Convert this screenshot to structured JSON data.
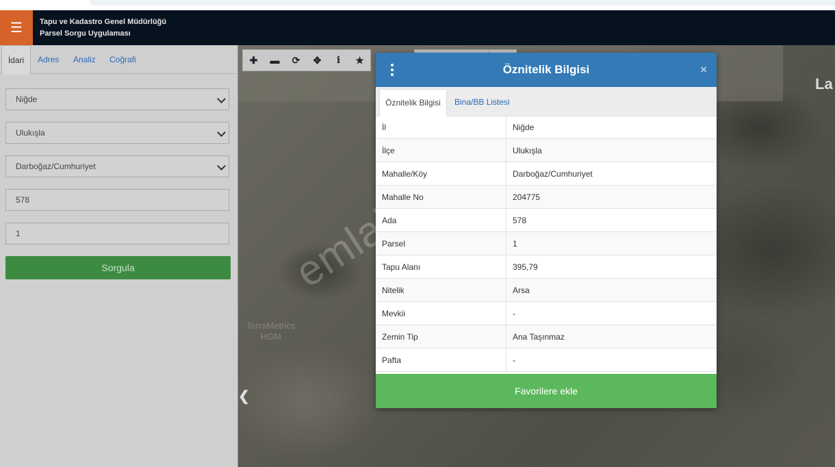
{
  "header": {
    "menu_icon": "hamburger-icon",
    "title_line1": "Tapu ve Kadastro Genel Müdürlüğü",
    "title_line2": "Parsel Sorgu Uygulaması"
  },
  "sidebar": {
    "tabs": [
      {
        "label": "İdari",
        "active": true
      },
      {
        "label": "Adres",
        "active": false
      },
      {
        "label": "Analiz",
        "active": false
      },
      {
        "label": "Coğrafi",
        "active": false
      }
    ],
    "province": "Niğde",
    "district": "Ulukışla",
    "neighborhood": "Darboğaz/Cumhuriyet",
    "block": "578",
    "parcel": "1",
    "query_button": "Sorgula"
  },
  "map": {
    "toolbar_icons": [
      "plus-icon",
      "minus-icon",
      "refresh-icon",
      "crosshair-icon",
      "info-icon",
      "star-icon"
    ],
    "watermark": "emlakjet.com",
    "edge_label": "La",
    "faint_text": "TerraMetrics\nHGM"
  },
  "modal": {
    "title": "Öznitelik Bilgisi",
    "close": "×",
    "tabs": [
      {
        "label": "Öznitelik Bilgisi",
        "active": true
      },
      {
        "label": "Bina/BB Listesi",
        "active": false
      }
    ],
    "rows": [
      {
        "key": "İl",
        "value": "Niğde"
      },
      {
        "key": "İlçe",
        "value": "Ulukışla"
      },
      {
        "key": "Mahalle/Köy",
        "value": "Darboğaz/Cumhuriyet"
      },
      {
        "key": "Mahalle No",
        "value": "204775"
      },
      {
        "key": "Ada",
        "value": "578"
      },
      {
        "key": "Parsel",
        "value": "1"
      },
      {
        "key": "Tapu Alanı",
        "value": "395,79"
      },
      {
        "key": "Nitelik",
        "value": "Arsa"
      },
      {
        "key": "Mevkii",
        "value": "-"
      },
      {
        "key": "Zemin Tip",
        "value": "Ana Taşınmaz"
      },
      {
        "key": "Pafta",
        "value": "-"
      }
    ],
    "favorite_button": "Favorilere ekle"
  },
  "colors": {
    "navbar": "#07121f",
    "menu_button": "#d6632a",
    "query_button": "#3c8b41",
    "modal_header": "#337ab7",
    "favorite_button": "#5cb85c"
  }
}
